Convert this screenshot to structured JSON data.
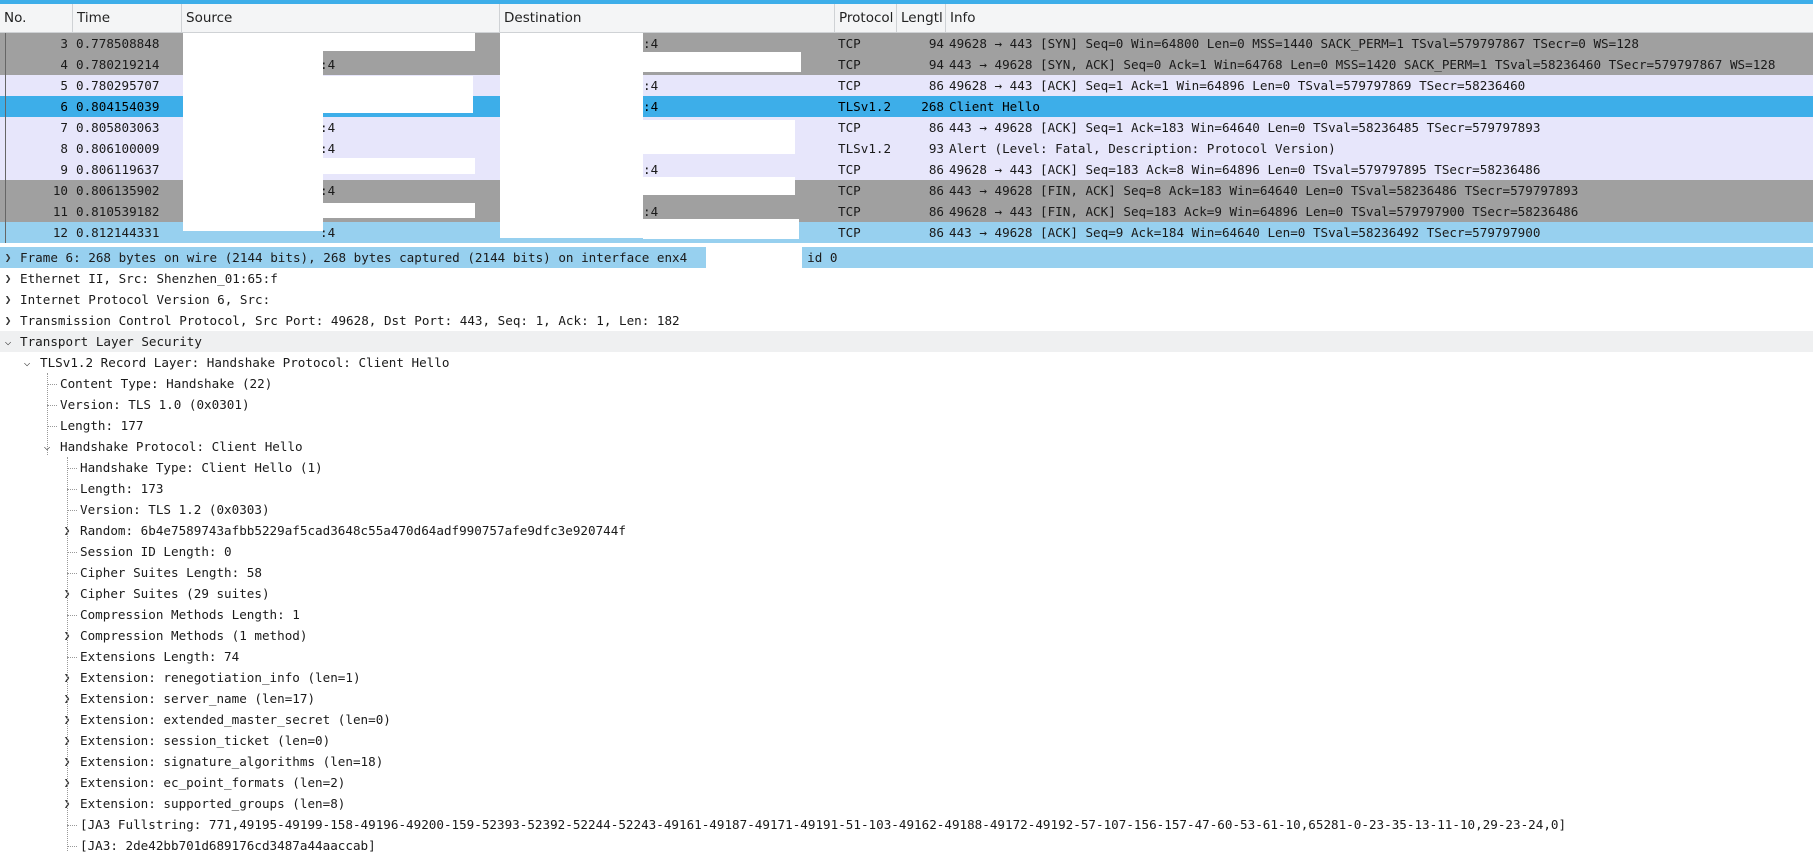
{
  "header": {
    "no": "No.",
    "time": "Time",
    "source": "Source",
    "destination": "Destination",
    "protocol": "Protocol",
    "length": "Lengtl",
    "info": "Info"
  },
  "packets": [
    {
      "no": "3",
      "time": "0.778508848",
      "src": "",
      "dst": ":4",
      "proto": "TCP",
      "len": "94",
      "info": "49628 → 443 [SYN] Seq=0 Win=64800 Len=0 MSS=1440 SACK_PERM=1 TSval=579797867 TSecr=0 WS=128"
    },
    {
      "no": "4",
      "time": "0.780219214",
      "src": ":4",
      "dst": "",
      "proto": "TCP",
      "len": "94",
      "info": "443 → 49628 [SYN, ACK] Seq=0 Ack=1 Win=64768 Len=0 MSS=1420 SACK_PERM=1 TSval=58236460 TSecr=579797867 WS=128"
    },
    {
      "no": "5",
      "time": "0.780295707",
      "src": "",
      "dst": ":4",
      "proto": "TCP",
      "len": "86",
      "info": "49628 → 443 [ACK] Seq=1 Ack=1 Win=64896 Len=0 TSval=579797869 TSecr=58236460"
    },
    {
      "no": "6",
      "time": "0.804154039",
      "src": "",
      "dst": ":4",
      "proto": "TLSv1.2",
      "len": "268",
      "info": "Client Hello"
    },
    {
      "no": "7",
      "time": "0.805803063",
      "src": ":4",
      "dst": "",
      "proto": "TCP",
      "len": "86",
      "info": "443 → 49628 [ACK] Seq=1 Ack=183 Win=64640 Len=0 TSval=58236485 TSecr=579797893"
    },
    {
      "no": "8",
      "time": "0.806100009",
      "src": ":4",
      "dst": "",
      "proto": "TLSv1.2",
      "len": "93",
      "info": "Alert (Level: Fatal, Description: Protocol Version)"
    },
    {
      "no": "9",
      "time": "0.806119637",
      "src": "",
      "dst": ":4",
      "proto": "TCP",
      "len": "86",
      "info": "49628 → 443 [ACK] Seq=183 Ack=8 Win=64896 Len=0 TSval=579797895 TSecr=58236486"
    },
    {
      "no": "10",
      "time": "0.806135902",
      "src": ":4",
      "dst": "",
      "proto": "TCP",
      "len": "86",
      "info": "443 → 49628 [FIN, ACK] Seq=8 Ack=183 Win=64640 Len=0 TSval=58236486 TSecr=579797893"
    },
    {
      "no": "11",
      "time": "0.810539182",
      "src": "",
      "dst": ":4",
      "proto": "TCP",
      "len": "86",
      "info": "49628 → 443 [FIN, ACK] Seq=183 Ack=9 Win=64896 Len=0 TSval=579797900 TSecr=58236486"
    },
    {
      "no": "12",
      "time": "0.812144331",
      "src": ":4",
      "dst": "",
      "proto": "TCP",
      "len": "86",
      "info": "443 → 49628 [ACK] Seq=9 Ack=184 Win=64640 Len=0 TSval=58236492 TSecr=579797900"
    }
  ],
  "details": [
    {
      "text": "Frame 6: 268 bytes on wire (2144 bits), 268 bytes captured (2144 bits) on interface enx4",
      "suffix": ", id 0"
    },
    {
      "text": "Ethernet II, Src: Shenzhen_01:65:f"
    },
    {
      "text": "Internet Protocol Version 6, Src:"
    },
    {
      "text": "Transmission Control Protocol, Src Port: 49628, Dst Port: 443, Seq: 1, Ack: 1, Len: 182"
    },
    {
      "text": "Transport Layer Security"
    },
    {
      "text": "TLSv1.2 Record Layer: Handshake Protocol: Client Hello"
    },
    {
      "text": "Content Type: Handshake (22)"
    },
    {
      "text": "Version: TLS 1.0 (0x0301)"
    },
    {
      "text": "Length: 177"
    },
    {
      "text": "Handshake Protocol: Client Hello"
    },
    {
      "text": "Handshake Type: Client Hello (1)"
    },
    {
      "text": "Length: 173"
    },
    {
      "text": "Version: TLS 1.2 (0x0303)"
    },
    {
      "text": "Random: 6b4e7589743afbb5229af5cad3648c55a470d64adf990757afe9dfc3e920744f"
    },
    {
      "text": "Session ID Length: 0"
    },
    {
      "text": "Cipher Suites Length: 58"
    },
    {
      "text": "Cipher Suites (29 suites)"
    },
    {
      "text": "Compression Methods Length: 1"
    },
    {
      "text": "Compression Methods (1 method)"
    },
    {
      "text": "Extensions Length: 74"
    },
    {
      "text": "Extension: renegotiation_info (len=1)"
    },
    {
      "text": "Extension: server_name (len=17)"
    },
    {
      "text": "Extension: extended_master_secret (len=0)"
    },
    {
      "text": "Extension: session_ticket (len=0)"
    },
    {
      "text": "Extension: signature_algorithms (len=18)"
    },
    {
      "text": "Extension: ec_point_formats (len=2)"
    },
    {
      "text": "Extension: supported_groups (len=8)"
    },
    {
      "text": "[JA3 Fullstring: 771,49195-49199-158-49196-49200-159-52393-52392-52244-52243-49161-49187-49171-49191-51-103-49162-49188-49172-49192-57-107-156-157-47-60-53-61-10,65281-0-23-35-13-11-10,29-23-24,0]"
    },
    {
      "text": "[JA3: 2de42bb701d689176cd3487a44aaccab]"
    }
  ]
}
